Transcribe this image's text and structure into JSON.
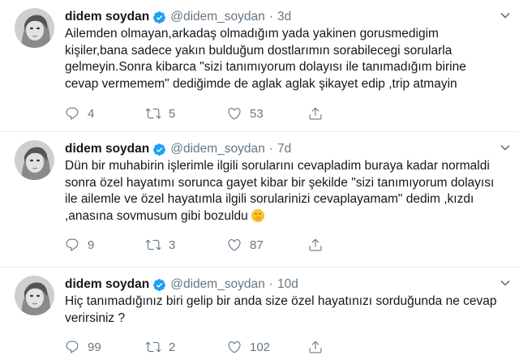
{
  "tweets": [
    {
      "name": "didem soydan",
      "handle": "@didem_soydan",
      "separator": "·",
      "time": "3d",
      "lines": [
        "Ailemden olmayan,arkadaş olmadığım yada yakinen gorusmedigim",
        "kişiler,bana sadece yakın bulduğum dostlarımın  sorabilecegi sorularla",
        "gelmeyin.Sonra kibarca \"sizi tanımıyorum dolayısı ile tanımadığım birine",
        "cevap vermemem\" dediğimde de aglak aglak şikayet edip ,trip atmayin"
      ],
      "replies": "4",
      "retweets": "5",
      "likes": "53"
    },
    {
      "name": "didem soydan",
      "handle": "@didem_soydan",
      "separator": "·",
      "time": "7d",
      "lines": [
        "Dün bir muhabirin işlerimle ilgili sorularını cevapladim buraya kadar normaldi",
        "sonra özel hayatımı sorunca gayet kibar bir şekilde \"sizi tanımıyorum dolayısı",
        "ile ailemle ve özel hayatımla ilgili sorularinizi cevaplayamam\" dedim ,kızdı",
        ",anasına sovmusum gibi bozuldu"
      ],
      "emoji": "face-with-hand-over-mouth",
      "replies": "9",
      "retweets": "3",
      "likes": "87"
    },
    {
      "name": "didem soydan",
      "handle": "@didem_soydan",
      "separator": "·",
      "time": "10d",
      "lines": [
        "Hiç tanımadığınız biri gelip bir anda size özel hayatınızı sorduğunda ne cevap",
        "verirsiniz ?"
      ],
      "replies": "99",
      "retweets": "2",
      "likes": "102"
    }
  ],
  "colors": {
    "verified": "#1da1f2",
    "secondary": "#657786",
    "text": "#14171a"
  }
}
